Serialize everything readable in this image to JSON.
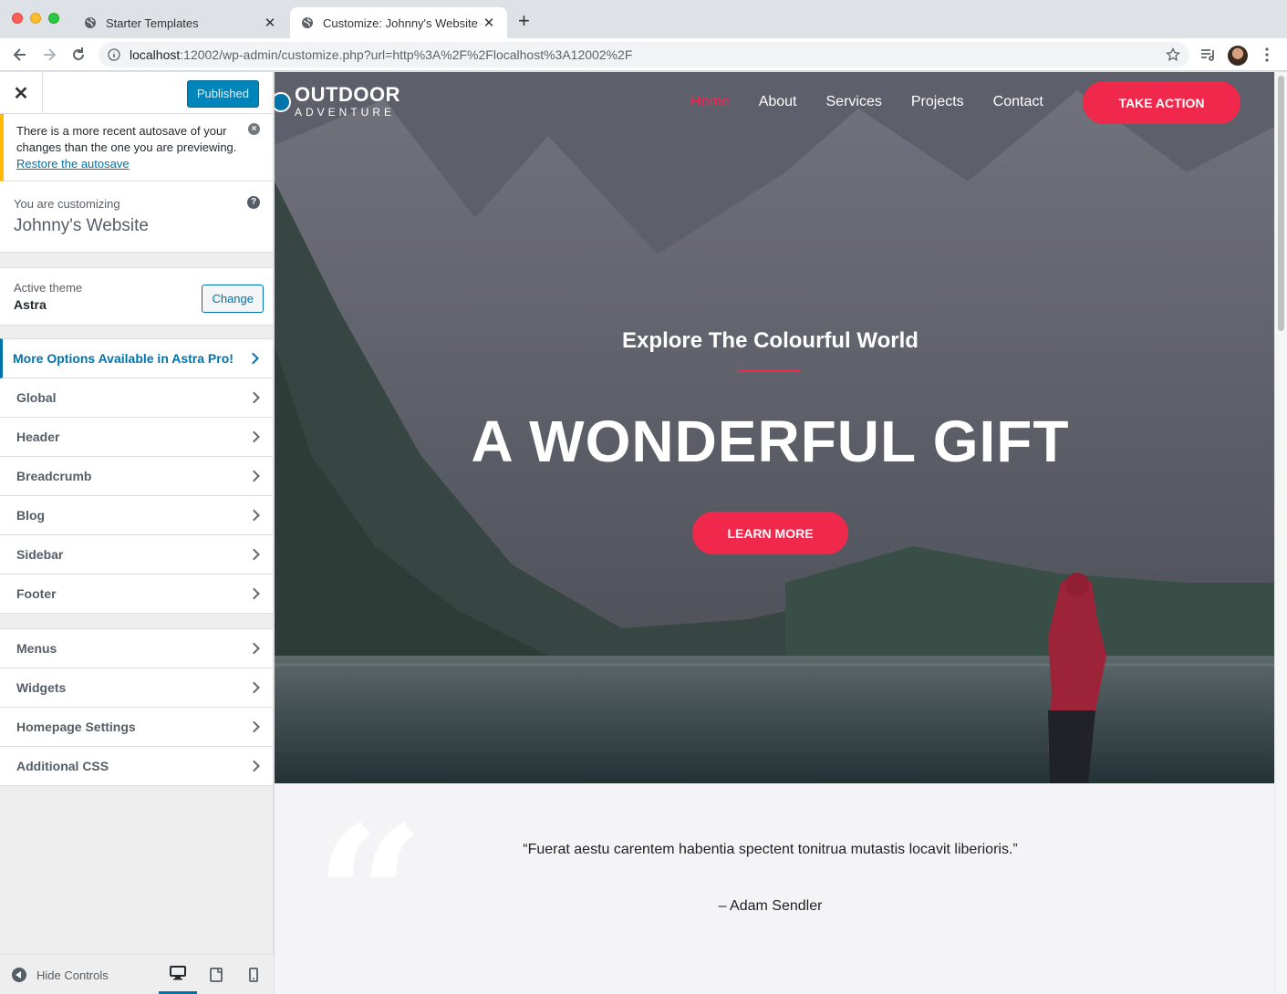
{
  "browser": {
    "tabs": [
      {
        "title": "Starter Templates",
        "active": false
      },
      {
        "title": "Customize: Johnny's Website –",
        "active": true
      }
    ],
    "url_host": "localhost",
    "url_rest": ":12002/wp-admin/customize.php?url=http%3A%2F%2Flocalhost%3A12002%2F"
  },
  "customizer": {
    "publish_label": "Published",
    "notice": {
      "text": "There is a more recent autosave of your changes than the one you are previewing.",
      "link": "Restore the autosave"
    },
    "customizing_label": "You are customizing",
    "site_name": "Johnny's Website",
    "active_theme_label": "Active theme",
    "theme_name": "Astra",
    "change_label": "Change",
    "pro_label": "More Options Available in Astra Pro!",
    "sections": [
      "Global",
      "Header",
      "Breadcrumb",
      "Blog",
      "Sidebar",
      "Footer"
    ],
    "sections2": [
      "Menus",
      "Widgets",
      "Homepage Settings",
      "Additional CSS"
    ],
    "hide_controls": "Hide Controls"
  },
  "site": {
    "logo_main": "OUTDOOR",
    "logo_sub": "ADVENTURE",
    "nav": [
      "Home",
      "About",
      "Services",
      "Projects",
      "Contact"
    ],
    "cta": "TAKE ACTION",
    "hero_subtitle": "Explore The Colourful World",
    "hero_title": "A WONDERFUL GIFT",
    "hero_button": "LEARN MORE",
    "quote": "“Fuerat aestu carentem habentia spectent tonitrua mutastis locavit liberioris.”",
    "quote_author": "– Adam Sendler",
    "quote_mark": "“"
  },
  "colors": {
    "accent": "#f0284c",
    "wp_blue": "#0073aa",
    "notice": "#ffb900"
  }
}
